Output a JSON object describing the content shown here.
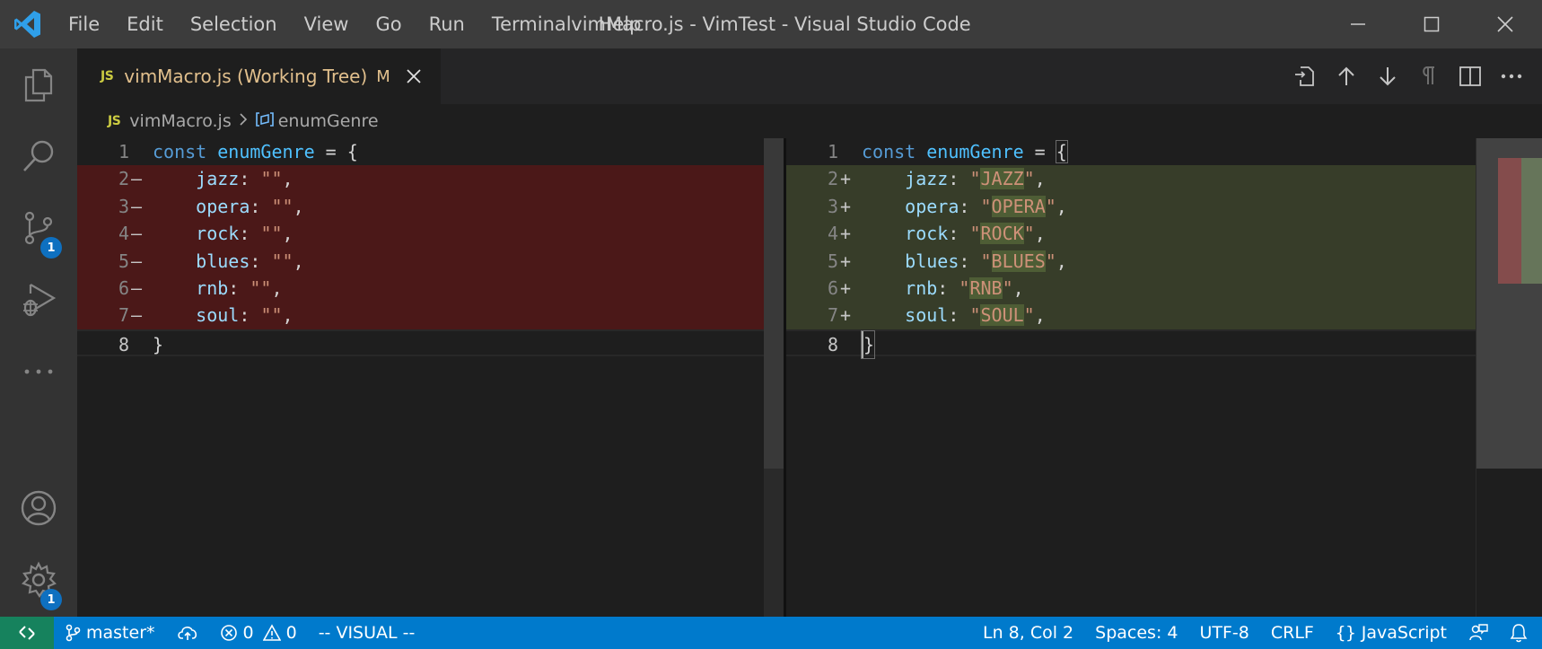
{
  "window": {
    "title": "vimMacro.js - VimTest - Visual Studio Code",
    "menu": [
      "File",
      "Edit",
      "Selection",
      "View",
      "Go",
      "Run",
      "Terminal",
      "Help"
    ]
  },
  "activity": {
    "items": [
      "explorer-icon",
      "search-icon",
      "source-control-icon",
      "run-debug-icon",
      "more-icon",
      "accounts-icon",
      "manage-gear-icon"
    ],
    "source_control_badge": "1",
    "manage_badge": "1"
  },
  "tab": {
    "icon_text": "JS",
    "label": "vimMacro.js (Working Tree)",
    "status": "M"
  },
  "editor_actions": [
    "open-file-icon",
    "previous-change-icon",
    "next-change-icon",
    "whitespace-icon",
    "split-editor-icon",
    "more-actions-icon"
  ],
  "breadcrumb": {
    "icon_text": "JS",
    "file": "vimMacro.js",
    "symbol": "enumGenre"
  },
  "diff": {
    "left": [
      {
        "n": "1",
        "m": "",
        "k": "const",
        "v": "enumGenre",
        "t": " = {"
      },
      {
        "n": "2",
        "m": "—",
        "p": "jazz",
        "s": "\"\""
      },
      {
        "n": "3",
        "m": "—",
        "p": "opera",
        "s": "\"\""
      },
      {
        "n": "4",
        "m": "—",
        "p": "rock",
        "s": "\"\""
      },
      {
        "n": "5",
        "m": "—",
        "p": "blues",
        "s": "\"\""
      },
      {
        "n": "6",
        "m": "—",
        "p": "rnb",
        "s": "\"\""
      },
      {
        "n": "7",
        "m": "—",
        "p": "soul",
        "s": "\"\""
      },
      {
        "n": "8",
        "m": "",
        "t": "}"
      }
    ],
    "right": [
      {
        "n": "1",
        "m": "",
        "k": "const",
        "v": "enumGenre",
        "t": " = {"
      },
      {
        "n": "2",
        "m": "+",
        "p": "jazz",
        "s": "JAZZ"
      },
      {
        "n": "3",
        "m": "+",
        "p": "opera",
        "s": "OPERA"
      },
      {
        "n": "4",
        "m": "+",
        "p": "rock",
        "s": "ROCK"
      },
      {
        "n": "5",
        "m": "+",
        "p": "blues",
        "s": "BLUES"
      },
      {
        "n": "6",
        "m": "+",
        "p": "rnb",
        "s": "RNB"
      },
      {
        "n": "7",
        "m": "+",
        "p": "soul",
        "s": "SOUL"
      },
      {
        "n": "8",
        "m": "",
        "t": "}"
      }
    ]
  },
  "status": {
    "branch": "master*",
    "errors": "0",
    "warnings": "0",
    "mode": "-- VISUAL --",
    "position": "Ln 8, Col 2",
    "spaces": "Spaces: 4",
    "encoding": "UTF-8",
    "eol": "CRLF",
    "language": "JavaScript"
  },
  "colors": {
    "titlebar": "#3c3c3c",
    "activitybar": "#333333",
    "statusbar": "#007acc",
    "removed_bg": "#4b1818",
    "inserted_bg": "#373d29"
  }
}
